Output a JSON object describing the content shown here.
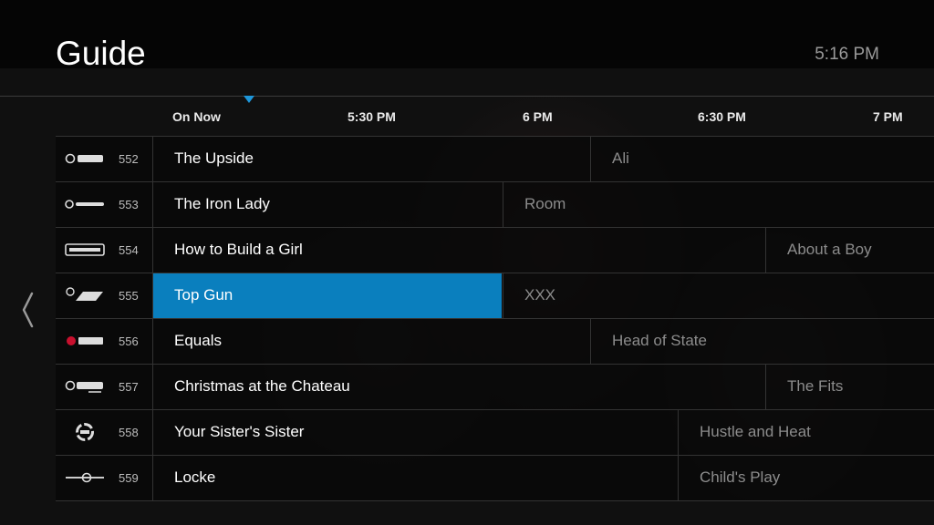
{
  "header": {
    "title": "Guide",
    "clock": "5:16 PM"
  },
  "timebar": {
    "labels": [
      "On Now",
      "5:30 PM",
      "6 PM",
      "6:30 PM",
      "7 PM"
    ]
  },
  "colors": {
    "accent": "#0a7fbe",
    "marker": "#1e97da"
  },
  "channels": [
    {
      "number": "552",
      "network": "SHO BET",
      "logo_icon": "sho-bet-logo-icon",
      "programs": [
        {
          "title": "The Upside"
        },
        {
          "title": "Ali"
        }
      ]
    },
    {
      "number": "553",
      "network": "SHO women",
      "logo_icon": "sho-women-logo-icon",
      "programs": [
        {
          "title": "The Iron Lady"
        },
        {
          "title": "Room"
        }
      ]
    },
    {
      "number": "554",
      "network": "SHOWCASE",
      "logo_icon": "showcase-logo-icon",
      "programs": [
        {
          "title": "How to Build a Girl"
        },
        {
          "title": "About a Boy"
        }
      ]
    },
    {
      "number": "555",
      "network": "SHO extreme",
      "logo_icon": "sho-extreme-logo-icon",
      "programs": [
        {
          "title": "Top Gun",
          "selected": true
        },
        {
          "title": "XXX"
        }
      ]
    },
    {
      "number": "556",
      "network": "SHO NEXT",
      "logo_icon": "sho-next-logo-icon",
      "programs": [
        {
          "title": "Equals"
        },
        {
          "title": "Head of State"
        }
      ]
    },
    {
      "number": "557",
      "network": "SHO family",
      "logo_icon": "sho-family-logo-icon",
      "programs": [
        {
          "title": "Christmas at the Chateau"
        },
        {
          "title": "The Fits"
        }
      ]
    },
    {
      "number": "558",
      "network": "The Movie Channel",
      "logo_icon": "the-movie-channel-logo-icon",
      "programs": [
        {
          "title": "Your Sister's Sister"
        },
        {
          "title": "Hustle and Heat"
        }
      ]
    },
    {
      "number": "559",
      "network": "The Movie Channel Xtra",
      "logo_icon": "the-movie-channel-xtra-logo-icon",
      "programs": [
        {
          "title": "Locke"
        },
        {
          "title": "Child's Play"
        }
      ]
    }
  ]
}
